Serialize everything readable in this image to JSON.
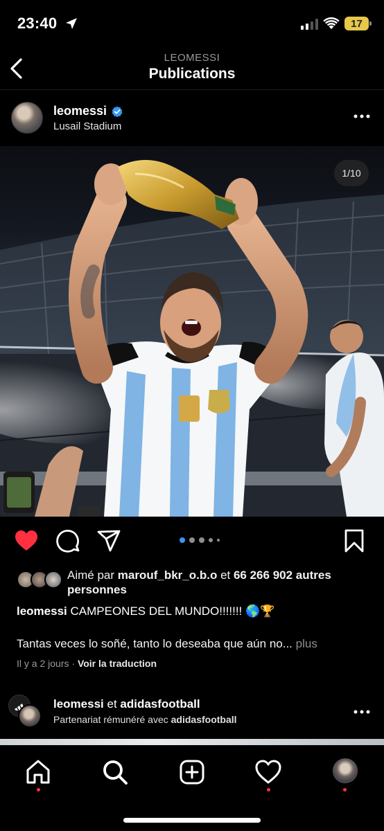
{
  "status_bar": {
    "time": "23:40",
    "battery": "17"
  },
  "header": {
    "subtitle": "LEOMESSI",
    "title": "Publications"
  },
  "post": {
    "username": "leomessi",
    "location": "Lusail Stadium",
    "media_counter": "1/10",
    "likes": {
      "prefix": "Aimé par ",
      "user": "marouf_bkr_o.b.o",
      "middle": " et ",
      "count": "66 266 902 autres personnes"
    },
    "caption_user": "leomessi",
    "caption_text": " CAMPEONES DEL MUNDO!!!!!!! 🌎🏆",
    "caption_line2": "Tantas veces lo soñé, tanto lo deseaba que aún no...",
    "more_label": "plus",
    "time_ago": "Il y a 2 jours",
    "separator": "·",
    "translate_label": "Voir la traduction"
  },
  "next_post": {
    "user1": "leomessi",
    "connector": " et ",
    "user2": "adidasfootball",
    "sub_prefix": "Partenariat rémunéré avec ",
    "sub_brand": "adidasfootball"
  },
  "icons": {
    "status": [
      "location-arrow-icon",
      "signal-icon",
      "wifi-icon",
      "battery-icon"
    ],
    "actions": [
      "heart-filled-icon",
      "comment-icon",
      "share-icon",
      "bookmark-icon"
    ],
    "nav": [
      "home-icon",
      "search-icon",
      "create-icon",
      "heart-icon",
      "profile-avatar"
    ]
  },
  "colors": {
    "like_red": "#ff3040",
    "verified_blue": "#3897f0",
    "background": "#000000"
  }
}
